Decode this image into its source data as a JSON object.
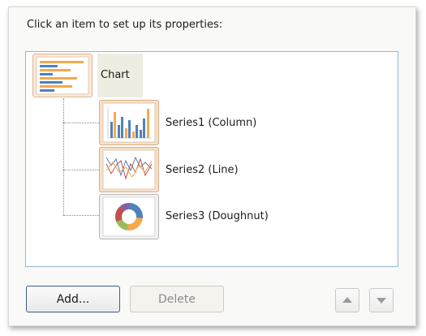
{
  "dialog": {
    "instruction": "Click an item to set up its properties:"
  },
  "tree": {
    "root": {
      "label": "Chart",
      "icon": "bar-chart-thumbnail-icon"
    },
    "children": [
      {
        "label": "Series1 (Column)",
        "icon": "column-chart-thumbnail-icon"
      },
      {
        "label": "Series2 (Line)",
        "icon": "line-chart-thumbnail-icon"
      },
      {
        "label": "Series3 (Doughnut)",
        "icon": "doughnut-chart-thumbnail-icon"
      }
    ]
  },
  "buttons": {
    "add": "Add...",
    "delete": "Delete",
    "move_up_icon": "arrow-up-icon",
    "move_down_icon": "arrow-down-icon"
  },
  "colors": {
    "tree_border": "#9ab3cf",
    "add_border": "#3f5e84",
    "delete_text": "#8d8d8d",
    "icon_orange": "#f4a94e",
    "icon_blue": "#4f81bd"
  }
}
